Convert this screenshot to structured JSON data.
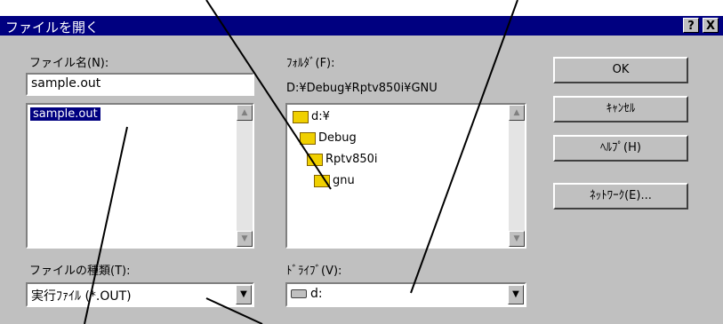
{
  "window": {
    "title": "ファイルを開く",
    "help_btn": "?",
    "close_btn": "X"
  },
  "filename": {
    "label": "ファイル名(N):",
    "value": "sample.out",
    "list": [
      "sample.out"
    ]
  },
  "folder": {
    "label": "ﾌｫﾙﾀﾞ(F):",
    "path": "D:¥Debug¥Rptv850i¥GNU",
    "tree": [
      "d:¥",
      "Debug",
      "Rptv850i",
      "gnu"
    ]
  },
  "filetype": {
    "label": "ファイルの種類(T):",
    "value": "実行ﾌｧｲﾙ (*.OUT)"
  },
  "drive": {
    "label": "ﾄﾞﾗｲﾌﾞ(V):",
    "value": "d:"
  },
  "buttons": {
    "ok": "OK",
    "cancel": "ｷｬﾝｾﾙ",
    "help": "ﾍﾙﾌﾟ(H)",
    "network": "ﾈｯﾄﾜｰｸ(E)..."
  },
  "colors": {
    "titlebar": "#000080",
    "dialog_bg": "#c0c0c0",
    "selection": "#000080"
  }
}
